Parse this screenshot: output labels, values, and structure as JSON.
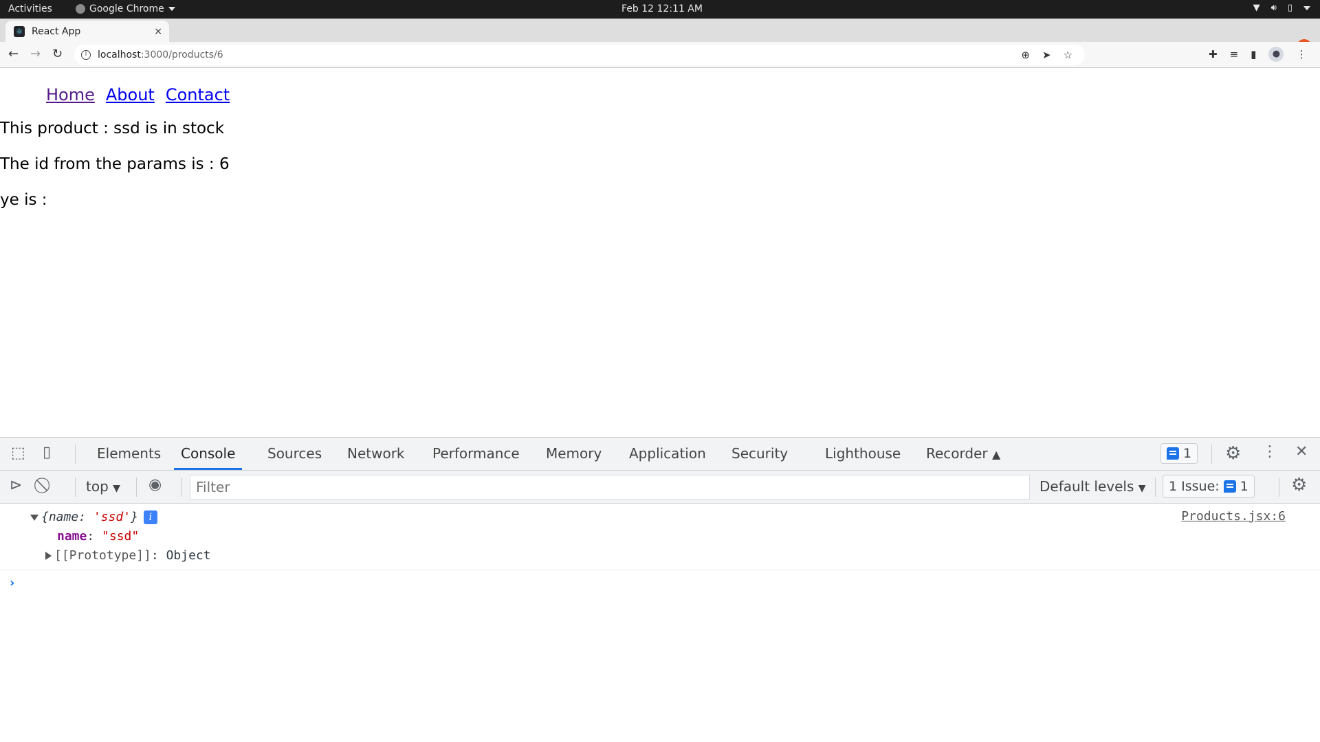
{
  "os_bar": {
    "activities": "Activities",
    "app_name": "Google Chrome",
    "clock": "Feb 12  12:11 AM",
    "tray_icons": [
      "wifi-icon",
      "volume-icon",
      "battery-icon",
      "system-menu-icon"
    ]
  },
  "browser": {
    "tab": {
      "title": "React App",
      "favicon": "react-logo-icon",
      "close": "×"
    },
    "new_tab": "+",
    "window_controls": {
      "tab_search": "⌄",
      "minimize": "–",
      "restore": "❐",
      "close": "×"
    },
    "nav": {
      "back": "←",
      "forward": "→",
      "reload": "↻"
    },
    "url": {
      "host": "localhost",
      "rest": ":3000/products/6"
    },
    "omnibox_icons": [
      "zoom-icon",
      "send-icon",
      "bookmark-star-icon"
    ],
    "extension_icons": [
      "extensions-icon",
      "media-icon",
      "side-panel-icon",
      "profile-icon",
      "menu-icon"
    ]
  },
  "page": {
    "nav_links": [
      {
        "label": "Home",
        "visited": true
      },
      {
        "label": "About",
        "visited": false
      },
      {
        "label": "Contact",
        "visited": false
      }
    ],
    "paragraphs": [
      "This product : ssd is in stock",
      "The id from the params is : 6",
      "ye is :"
    ]
  },
  "devtools": {
    "tabs": [
      "Elements",
      "Console",
      "Sources",
      "Network",
      "Performance",
      "Memory",
      "Application",
      "Security",
      "Lighthouse",
      "Recorder"
    ],
    "active_tab": "Console",
    "issues_count": "1",
    "toolbar": {
      "context": "top",
      "filter_placeholder": "Filter",
      "levels": "Default levels",
      "issues_label": "1 Issue:",
      "issues_count": "1"
    },
    "console": {
      "entry": {
        "summary_open": "{",
        "summary_key": "name",
        "summary_sep": ": ",
        "summary_val": "'ssd'",
        "summary_close": "}",
        "info_badge": "i",
        "prop_key": "name",
        "prop_sep": ": ",
        "prop_val": "\"ssd\"",
        "proto_label": "[[Prototype]]",
        "proto_sep": ": ",
        "proto_val": "Object",
        "source": "Products.jsx:6"
      },
      "prompt": "›"
    }
  }
}
